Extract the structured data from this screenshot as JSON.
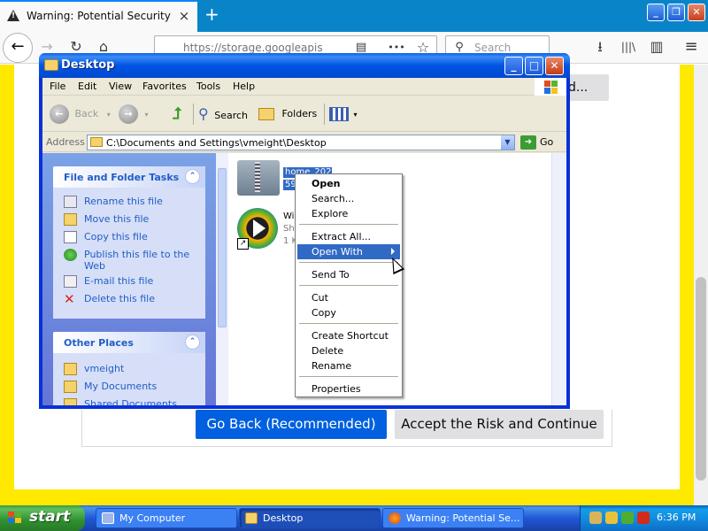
{
  "browser": {
    "tab_title": "Warning: Potential Security Risk Ahead",
    "tab_close": "×",
    "new_tab": "+",
    "url": "https://storage.googleapis",
    "search_placeholder": "Search",
    "back_icon": "←",
    "forward_icon": "→",
    "reload_icon": "↻",
    "home_icon": "⌂",
    "reader_icon": "▤",
    "more_icon": "•••",
    "star_icon": "☆",
    "download_icon": "⭳",
    "library_icon": "|||\\",
    "sidebar_icon": "▥",
    "menu_icon": "≡"
  },
  "warning_page": {
    "go_back_label": "Go Back (Recommended)",
    "accept_label": "Accept the Risk and Continue",
    "advanced_partial_label": "d..."
  },
  "explorer": {
    "title": "Desktop",
    "menu": [
      "File",
      "Edit",
      "View",
      "Favorites",
      "Tools",
      "Help"
    ],
    "toolbar": {
      "back": "Back",
      "search": "Search",
      "folders": "Folders"
    },
    "address_label": "Address",
    "address_value": "C:\\Documents and Settings\\vmeight\\Desktop",
    "go_label": "Go",
    "file_tasks": {
      "title": "File and Folder Tasks",
      "items": [
        "Rename this file",
        "Move this file",
        "Copy this file",
        "Publish this file to the Web",
        "E-mail this file",
        "Delete this file"
      ]
    },
    "other_places": {
      "title": "Other Places",
      "items": [
        "vmeight",
        "My Documents",
        "Shared Documents"
      ]
    },
    "files": [
      {
        "name": "home_2021",
        "detail": "592"
      },
      {
        "name": "Windows Media Player",
        "type": "Shortcut",
        "size": "1 KB"
      }
    ]
  },
  "context_menu": {
    "items": [
      "Open",
      "Search...",
      "Explore",
      "Extract All...",
      "Open With",
      "Send To",
      "Cut",
      "Copy",
      "Create Shortcut",
      "Delete",
      "Rename",
      "Properties"
    ]
  },
  "taskbar": {
    "start_label": "start",
    "tasks": [
      "My Computer",
      "Desktop",
      "Warning: Potential Se..."
    ],
    "clock": "6:36 PM"
  },
  "colors": {
    "xp_blue": "#0054e3",
    "selection": "#316ac5",
    "firefox_blue_button": "#0060df",
    "warning_yellow": "#ffe900",
    "start_green": "#3c9a3c"
  }
}
